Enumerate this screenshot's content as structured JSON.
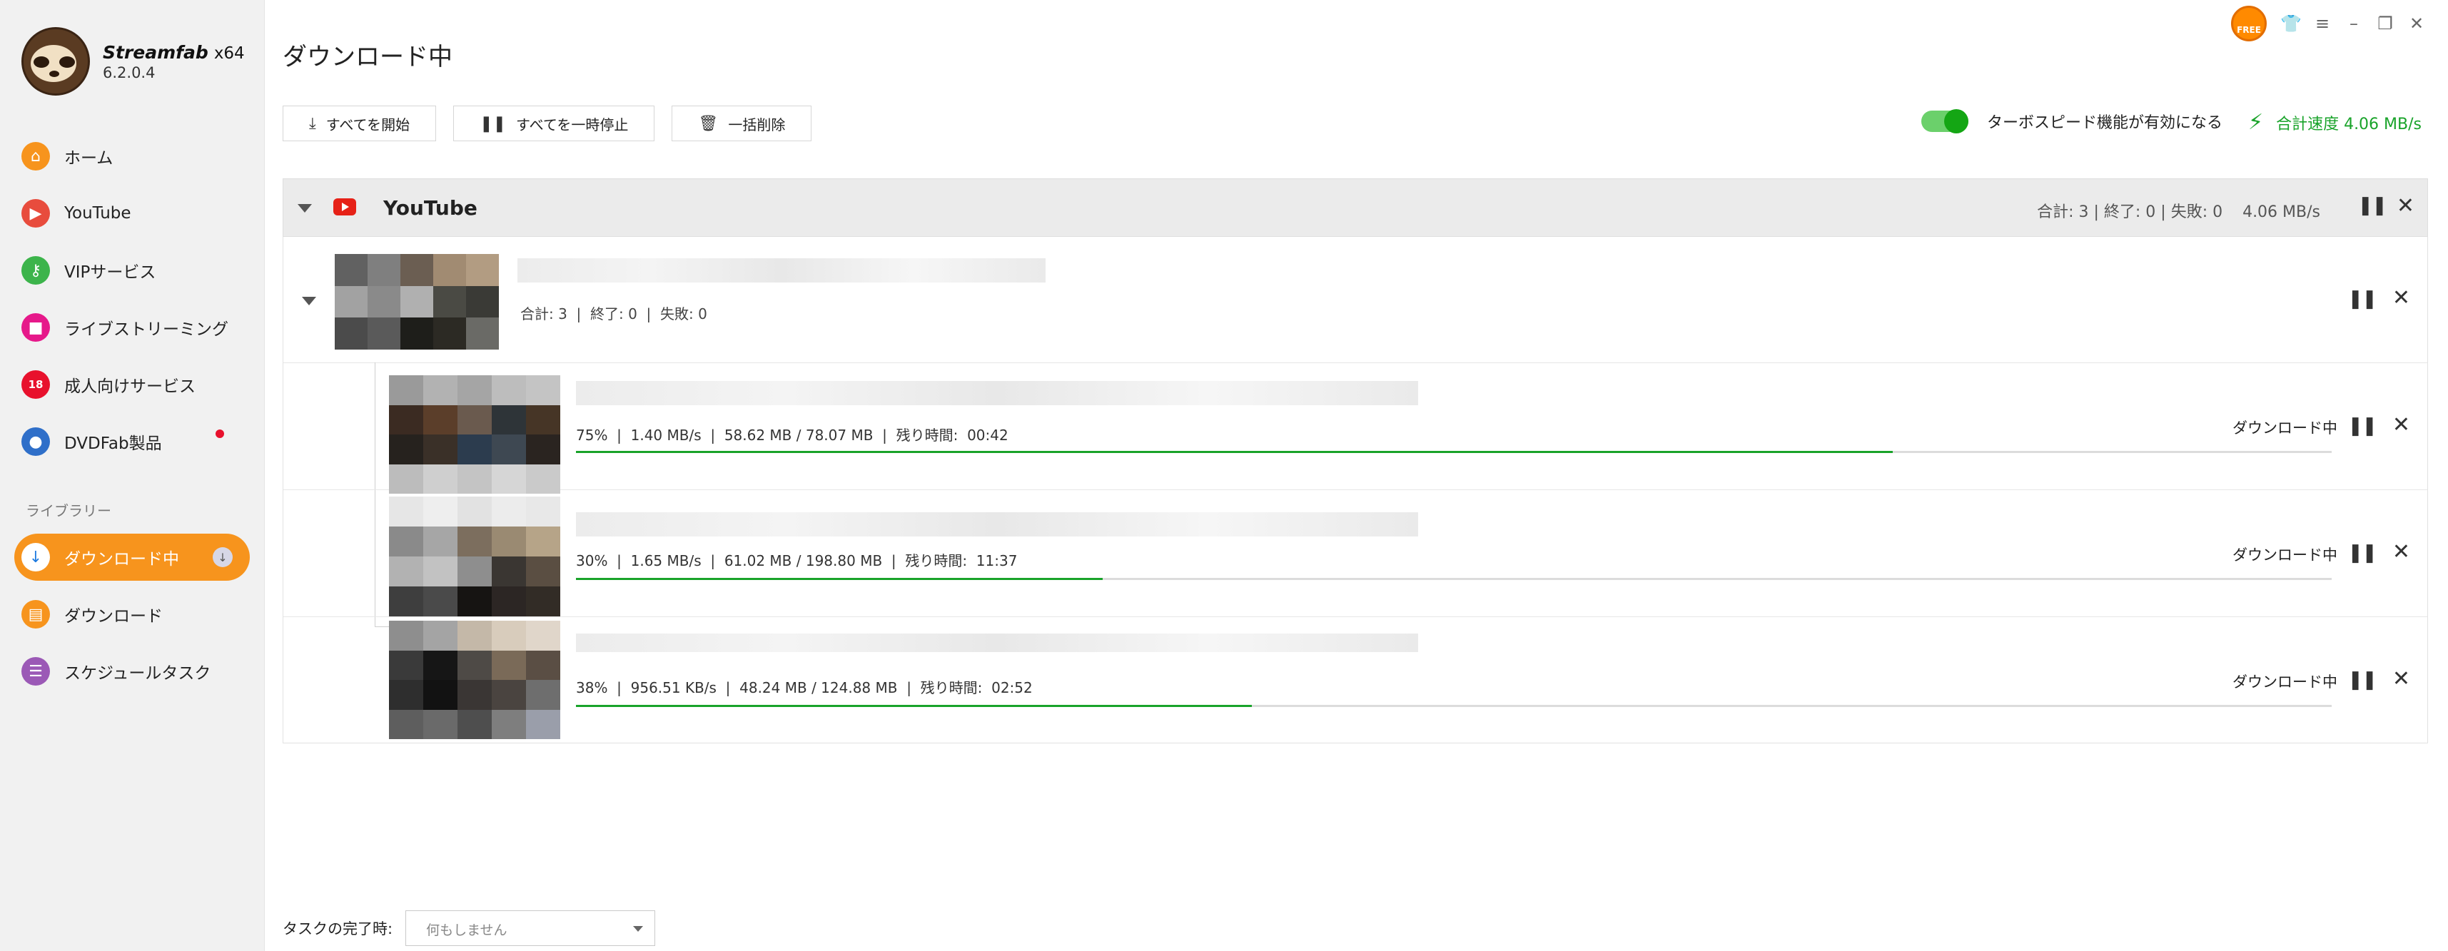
{
  "app": {
    "name": "Streamfab",
    "arch": "x64",
    "version": "6.2.0.4",
    "free_badge": "FREE"
  },
  "window_controls": [
    "shirt-icon",
    "menu-icon",
    "minimize-icon",
    "restore-icon",
    "close-icon"
  ],
  "sidebar": {
    "items": [
      {
        "label": "ホーム",
        "icon": "home-icon",
        "color": "#f7941d"
      },
      {
        "label": "YouTube",
        "icon": "youtube-icon",
        "color": "#e84c3d"
      },
      {
        "label": "VIPサービス",
        "icon": "key-icon",
        "color": "#3cb44b"
      },
      {
        "label": "ライブストリーミング",
        "icon": "camera-icon",
        "color": "#e6198a"
      },
      {
        "label": "成人向けサービス",
        "icon": "no-18-icon",
        "color": "#e8112d"
      },
      {
        "label": "DVDFab製品",
        "icon": "dvdfab-icon",
        "color": "#2f6fc9"
      }
    ],
    "library_header": "ライブラリー",
    "library_items": [
      {
        "label": "ダウンロード中",
        "icon": "download-icon",
        "color": "#1e7be0",
        "active": true
      },
      {
        "label": "ダウンロード",
        "icon": "folder-icon",
        "color": "#f7941d"
      },
      {
        "label": "スケジュールタスク",
        "icon": "schedule-icon",
        "color": "#9b59b6"
      }
    ]
  },
  "main": {
    "title": "ダウンロード中",
    "toolbar": {
      "start_all": "すべてを開始",
      "pause_all": "すべてを一時停止",
      "delete_all": "一括削除"
    },
    "turbo_label": "ターボスピード機能が有効になる",
    "turbo_enabled": true,
    "total_speed": "合計速度 4.06 MB/s",
    "group": {
      "title": "YouTube",
      "stats": "合計: 3 | 終了: 0 | 失敗: 0    4.06 MB/s"
    },
    "parent": {
      "stats": "合計: 3  |  終了: 0  |  失敗: 0"
    },
    "children": [
      {
        "stats": "75%  |  1.40 MB/s  |  58.62 MB / 78.07 MB  |  残り時間:  00:42",
        "progress": 0.75,
        "status": "ダウンロード中"
      },
      {
        "stats": "30%  |  1.65 MB/s  |  61.02 MB / 198.80 MB  |  残り時間:  11:37",
        "progress": 0.3,
        "status": "ダウンロード中"
      },
      {
        "stats": "38%  |  956.51 KB/s  |  48.24 MB / 124.88 MB  |  残り時間:  02:52",
        "progress": 0.385,
        "status": "ダウンロード中"
      }
    ]
  },
  "footer": {
    "label": "タスクの完了時:",
    "select_value": "何もしません"
  },
  "colors": {
    "accent": "#f7941d",
    "progress": "#19a32a",
    "toggle_on": "#14a614"
  }
}
